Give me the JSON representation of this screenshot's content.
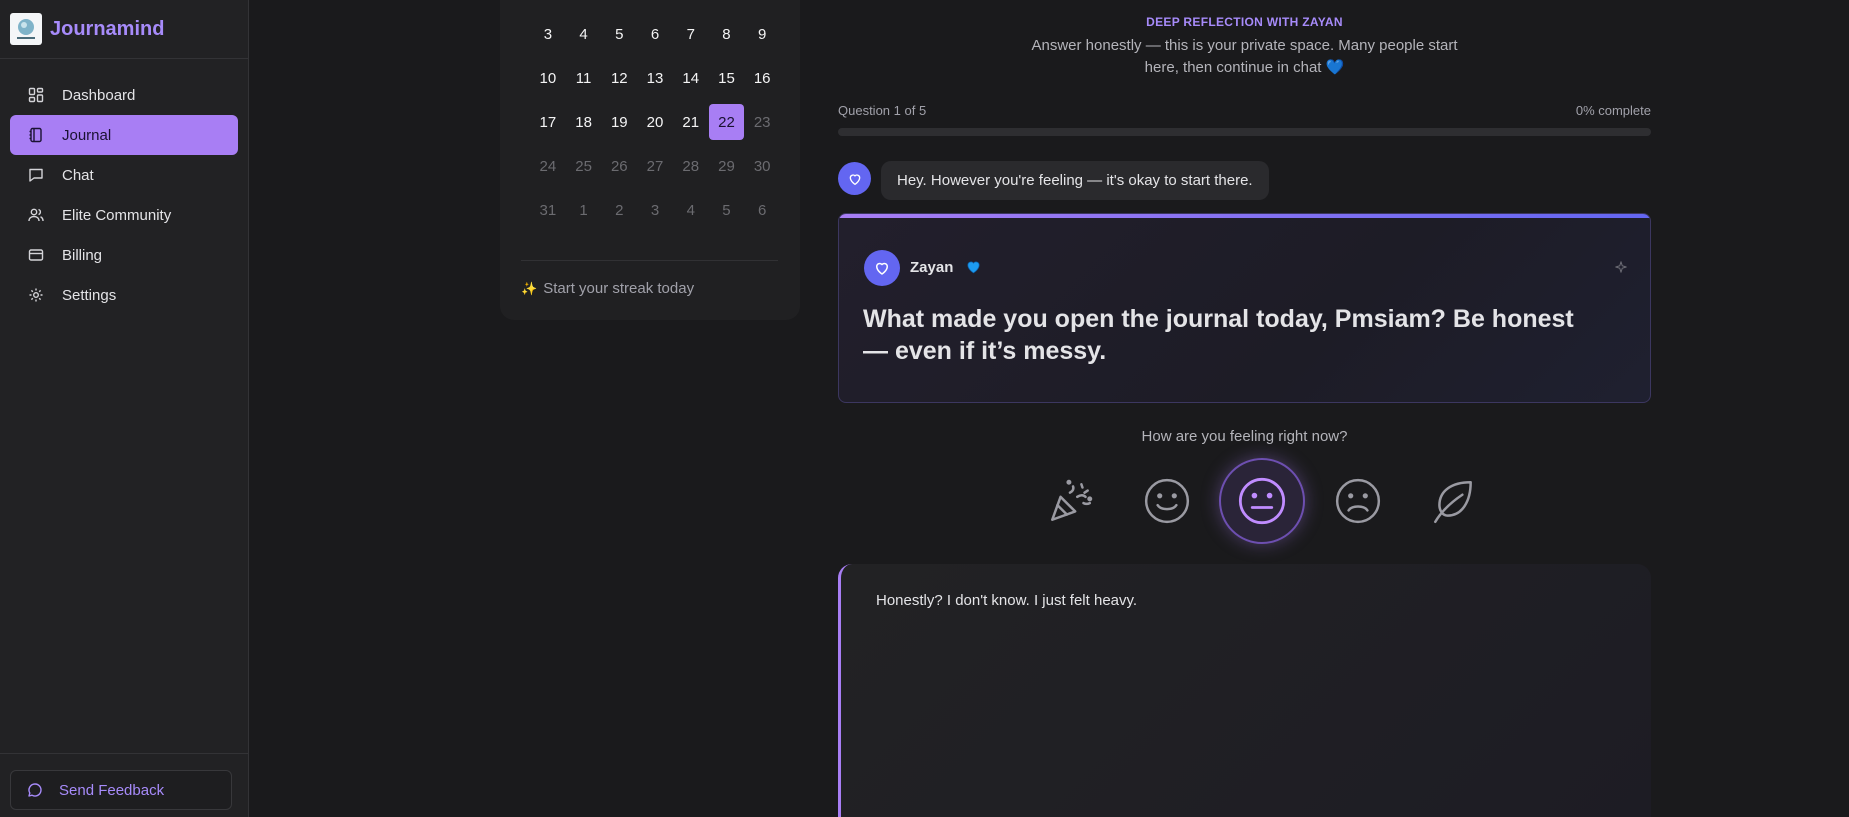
{
  "app": {
    "name": "Journamind"
  },
  "sidebar": {
    "items": [
      {
        "label": "Dashboard",
        "icon": "dashboard-icon"
      },
      {
        "label": "Journal",
        "icon": "journal-icon",
        "active": true
      },
      {
        "label": "Chat",
        "icon": "chat-icon"
      },
      {
        "label": "Elite Community",
        "icon": "users-icon"
      },
      {
        "label": "Billing",
        "icon": "credit-card-icon"
      },
      {
        "label": "Settings",
        "icon": "gear-icon"
      }
    ],
    "feedback_label": "Send Feedback"
  },
  "calendar": {
    "weeks": [
      [
        "3",
        "4",
        "5",
        "6",
        "7",
        "8",
        "9"
      ],
      [
        "10",
        "11",
        "12",
        "13",
        "14",
        "15",
        "16"
      ],
      [
        "17",
        "18",
        "19",
        "20",
        "21",
        "22",
        "23"
      ],
      [
        "24",
        "25",
        "26",
        "27",
        "28",
        "29",
        "30"
      ],
      [
        "31",
        "1",
        "2",
        "3",
        "4",
        "5",
        "6"
      ]
    ],
    "today": "22",
    "streak_text": "Start your streak today"
  },
  "reflection": {
    "eyebrow": "DEEP REFLECTION WITH ZAYAN",
    "intro": "Answer honestly — this is your private space. Many people start here, then continue in chat",
    "progress_label": "Question 1 of 5",
    "progress_pct_label": "0% complete",
    "progress_value": 0,
    "bot_message": "Hey. However you're feeling — it's okay to start there.",
    "coach_name": "Zayan",
    "question": "What made you open the journal today, Pmsiam? Be honest — even if it’s messy.",
    "feeling_prompt": "How are you feeling right now?",
    "moods": [
      "celebrate-icon",
      "happy-face-icon",
      "neutral-face-icon",
      "sad-face-icon",
      "leaf-icon"
    ],
    "selected_mood": "neutral-face-icon",
    "answer_text": "Honestly? I don't know. I just felt heavy."
  },
  "colors": {
    "accent": "#a87ef4",
    "bot_avatar": "#6366f1",
    "heart": "#3b82f6"
  }
}
